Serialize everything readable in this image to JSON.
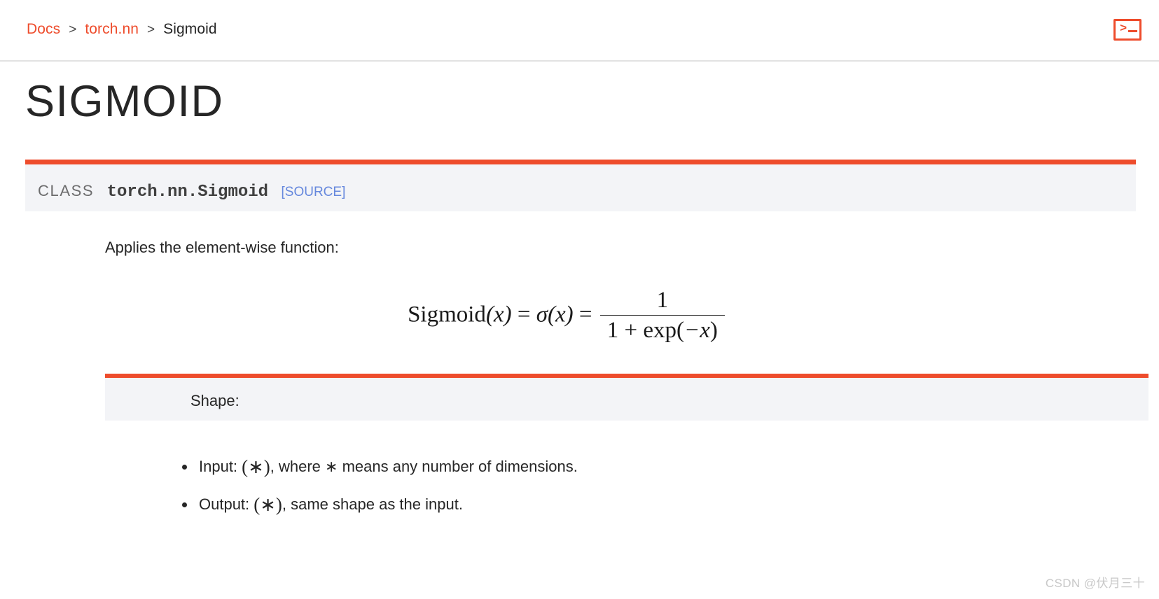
{
  "header": {
    "breadcrumb": [
      {
        "label": "Docs",
        "type": "link"
      },
      {
        "label": ">",
        "type": "separator"
      },
      {
        "label": "torch.nn",
        "type": "link"
      },
      {
        "label": ">",
        "type": "separator"
      },
      {
        "label": "Sigmoid",
        "type": "current"
      }
    ],
    "breadcrumb_items": {
      "docs": "Docs",
      "sep1": ">",
      "torch_nn": "torch.nn",
      "sep2": ">",
      "current": "Sigmoid"
    },
    "terminal_icon": {
      "name": "terminal-icon",
      "prompt": ">"
    }
  },
  "page": {
    "title": "SIGMOID"
  },
  "signature": {
    "class_keyword": "CLASS",
    "qualified_name": "torch.nn.Sigmoid",
    "source_link": "[SOURCE]"
  },
  "body": {
    "description": "Applies the element-wise function:",
    "formula": {
      "lhs_name": "Sigmoid",
      "lhs_arg": "(x)",
      "eq1": "=",
      "sigma": "σ",
      "sigma_arg": "(x)",
      "eq2": "=",
      "numerator": "1",
      "denominator_prefix": "1 + exp(",
      "denominator_arg": "−x",
      "denominator_suffix": ")",
      "plain": "Sigmoid(x) = σ(x) = 1 / (1 + exp(−x))"
    }
  },
  "shape": {
    "heading": "Shape:",
    "items": [
      {
        "prefix": "Input: ",
        "math": "(∗)",
        "suffix": ", where ∗ means any number of dimensions."
      },
      {
        "prefix": "Output: ",
        "math": "(∗)",
        "suffix": ", same shape as the input."
      }
    ]
  },
  "watermark": {
    "text": "CSDN @伏月三十"
  },
  "colors": {
    "brand_orange": "#ee4c2c",
    "panel_gray": "#f3f4f7",
    "link_blue": "#6688dd",
    "text_dark": "#262626",
    "muted_gray": "#6c6c6d"
  }
}
